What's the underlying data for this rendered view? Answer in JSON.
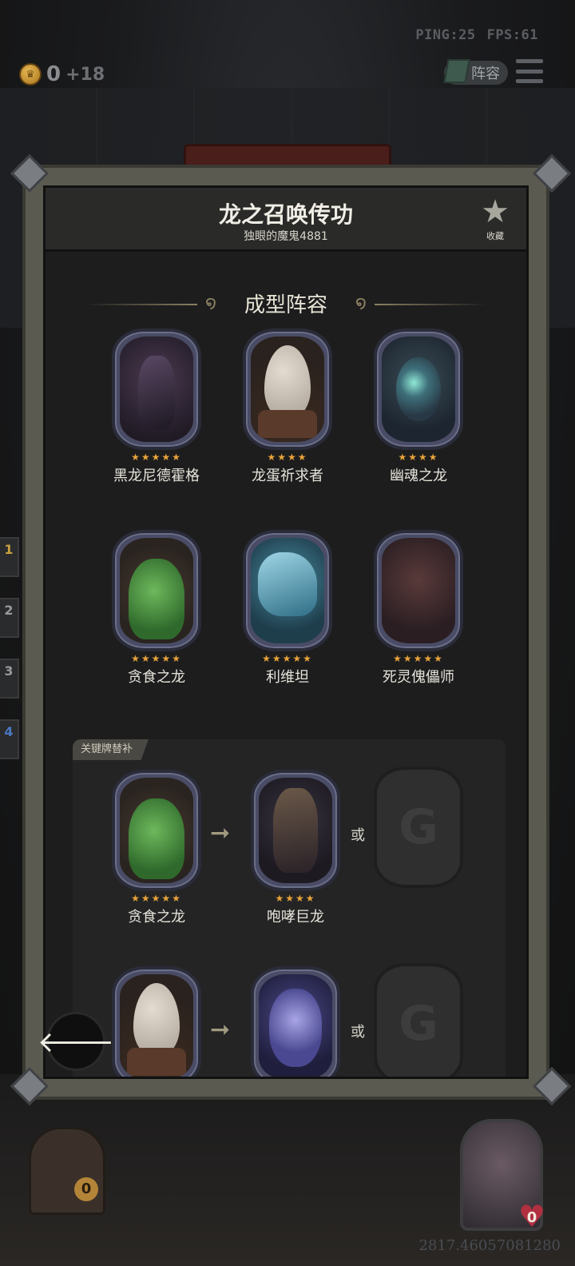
{
  "hud": {
    "ping": "PING:25",
    "fps": "FPS:61",
    "coins": "0",
    "coin_income": "+18",
    "team_button": "阵容"
  },
  "dialog": {
    "title": "龙之召唤传功",
    "author": "独眼的魔鬼4881",
    "favorite_label": "收藏",
    "section_title": "成型阵容",
    "core_cards": [
      {
        "name": "黑龙尼德霍格",
        "stars": "★★★★★",
        "art": "black-dragon"
      },
      {
        "name": "龙蛋祈求者",
        "stars": "★★★★",
        "art": "dragon-egg"
      },
      {
        "name": "幽魂之龙",
        "stars": "★★★★",
        "art": "ghost-dragon"
      },
      {
        "name": "贪食之龙",
        "stars": "★★★★★",
        "art": "greedy-dragon"
      },
      {
        "name": "利维坦",
        "stars": "★★★★★",
        "art": "leviathan"
      },
      {
        "name": "死灵傀儡师",
        "stars": "★★★★★",
        "art": "necro-puppeteer"
      }
    ],
    "replace_section_label": "关键牌替补",
    "or_text": "或",
    "replacements": [
      {
        "from": {
          "name": "贪食之龙",
          "stars": "★★★★★"
        },
        "to": {
          "name": "咆哮巨龙",
          "stars": "★★★★"
        }
      },
      {
        "from": {
          "name": "",
          "stars": ""
        },
        "to": {
          "name": "",
          "stars": ""
        }
      }
    ]
  },
  "side_tabs": [
    "1",
    "2",
    "3",
    "4"
  ],
  "bottom": {
    "chest_count": "0",
    "hero_hp": "0",
    "coords": "2817.46057081280"
  }
}
